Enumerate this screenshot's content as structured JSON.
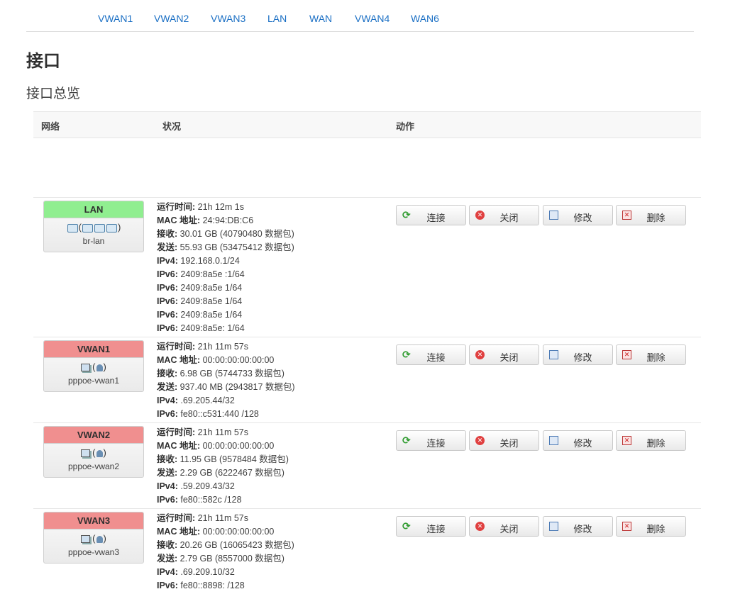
{
  "tabs": [
    "VWAN1",
    "VWAN2",
    "VWAN3",
    "LAN",
    "WAN",
    "VWAN4",
    "WAN6"
  ],
  "page_title": "接口",
  "section_title": "接口总览",
  "table_headers": {
    "network": "网络",
    "status": "状况",
    "actions": "动作"
  },
  "button_labels": {
    "connect": "连接",
    "stop": "关闭",
    "edit": "修改",
    "delete": "删除"
  },
  "colors": {
    "up": "#90ee90",
    "down": "#f08f8f",
    "link": "#1a6fc4"
  },
  "interfaces": [
    {
      "name": "LAN",
      "device": "br-lan",
      "state_color": "green",
      "icons": [
        "ethernet-icon",
        "bridge-icon"
      ],
      "status": [
        {
          "label": "运行时间:",
          "value": " 21h 12m 1s"
        },
        {
          "label": "MAC 地址:",
          "value": "        24:94:DB:C6"
        },
        {
          "label": "接收:",
          "value": " 30.01 GB (40790480 数据包)"
        },
        {
          "label": "发送:",
          "value": " 55.93 GB (53475412 数据包)"
        },
        {
          "label": "IPv4:",
          "value": " 192.168.0.1/24"
        },
        {
          "label": "IPv6:",
          "value": " 2409:8a5e               :1/64"
        },
        {
          "label": "IPv6:",
          "value": " 2409:8a5e               1/64"
        },
        {
          "label": "IPv6:",
          "value": " 2409:8a5e               1/64"
        },
        {
          "label": "IPv6:",
          "value": " 2409:8a5e               1/64"
        },
        {
          "label": "IPv6:",
          "value": " 2409:8a5e:              1/64"
        }
      ]
    },
    {
      "name": "VWAN1",
      "device": "pppoe-vwan1",
      "state_color": "red",
      "status": [
        {
          "label": "运行时间:",
          "value": " 21h 11m 57s"
        },
        {
          "label": "MAC 地址:",
          "value": " 00:00:00:00:00:00"
        },
        {
          "label": "接收:",
          "value": " 6.98 GB (5744733 数据包)"
        },
        {
          "label": "发送:",
          "value": " 937.40 MB (2943817 数据包)"
        },
        {
          "label": "IPv4:",
          "value": "    .69.205.44/32"
        },
        {
          "label": "IPv6:",
          "value": " fe80::c531:440              /128"
        }
      ]
    },
    {
      "name": "VWAN2",
      "device": "pppoe-vwan2",
      "state_color": "red",
      "status": [
        {
          "label": "运行时间:",
          "value": " 21h 11m 57s"
        },
        {
          "label": "MAC 地址:",
          "value": " 00:00:00:00:00:00"
        },
        {
          "label": "接收:",
          "value": " 11.95 GB (9578484 数据包)"
        },
        {
          "label": "发送:",
          "value": " 2.29 GB (6222467 数据包)"
        },
        {
          "label": "IPv4:",
          "value": "     .59.209.43/32"
        },
        {
          "label": "IPv6:",
          "value": " fe80::582c                 /128"
        }
      ]
    },
    {
      "name": "VWAN3",
      "device": "pppoe-vwan3",
      "state_color": "red",
      "status": [
        {
          "label": "运行时间:",
          "value": " 21h 11m 57s"
        },
        {
          "label": "MAC 地址:",
          "value": " 00:00:00:00:00:00"
        },
        {
          "label": "接收:",
          "value": " 20.26 GB (16065423 数据包)"
        },
        {
          "label": "发送:",
          "value": " 2.79 GB (8557000 数据包)"
        },
        {
          "label": "IPv4:",
          "value": "     .69.209.10/32"
        },
        {
          "label": "IPv6:",
          "value": " fe80::8898:              /128"
        }
      ]
    }
  ]
}
